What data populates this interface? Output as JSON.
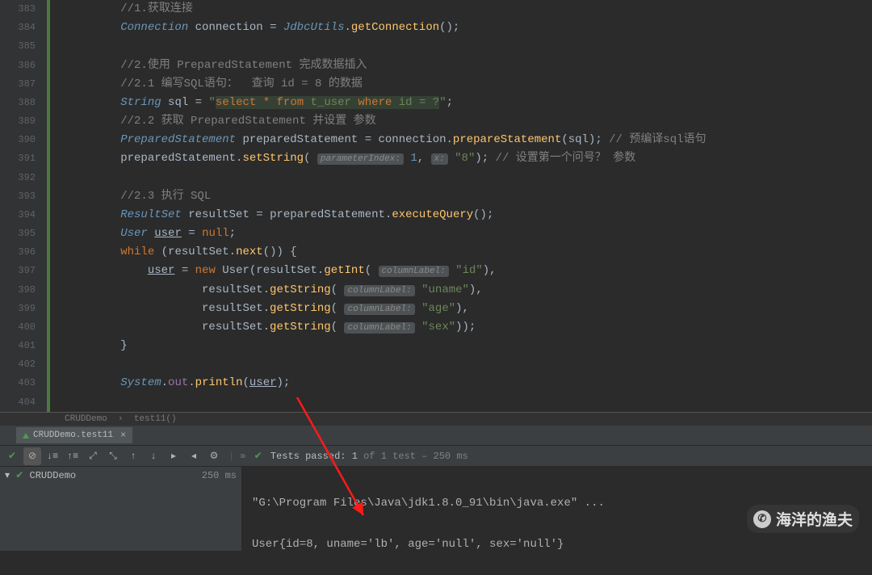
{
  "lines": [
    {
      "num": "383",
      "kind": "comment",
      "text": "//1.获取连接"
    },
    {
      "num": "384",
      "kind": "conn"
    },
    {
      "num": "385",
      "kind": "blank"
    },
    {
      "num": "386",
      "kind": "comment",
      "text": "//2.使用 PreparedStatement 完成数据插入"
    },
    {
      "num": "387",
      "kind": "comment",
      "text": "//2.1 编写SQL语句：  查询 id = 8 的数据"
    },
    {
      "num": "388",
      "kind": "sql"
    },
    {
      "num": "389",
      "kind": "comment",
      "text": "//2.2 获取 PreparedStatement 并设置 参数"
    },
    {
      "num": "390",
      "kind": "prep"
    },
    {
      "num": "391",
      "kind": "setstr"
    },
    {
      "num": "392",
      "kind": "blank"
    },
    {
      "num": "393",
      "kind": "comment",
      "text": "//2.3 执行 SQL"
    },
    {
      "num": "394",
      "kind": "resultset"
    },
    {
      "num": "395",
      "kind": "usernull"
    },
    {
      "num": "396",
      "kind": "while"
    },
    {
      "num": "397",
      "kind": "newuser_id"
    },
    {
      "num": "398",
      "kind": "getstr",
      "col": "uname"
    },
    {
      "num": "399",
      "kind": "getstr",
      "col": "age"
    },
    {
      "num": "400",
      "kind": "getstr_last",
      "col": "sex"
    },
    {
      "num": "401",
      "kind": "closebrace"
    },
    {
      "num": "402",
      "kind": "blank"
    },
    {
      "num": "403",
      "kind": "println"
    },
    {
      "num": "404",
      "kind": "blank"
    }
  ],
  "tokens": {
    "Connection": "Connection",
    "connection": "connection",
    "JdbcUtils": "JdbcUtils",
    "getConnection": "getConnection",
    "String": "String",
    "sql": "sql",
    "sql_select": "select",
    "sql_star": "*",
    "sql_from": "from",
    "sql_tuser": "t_user",
    "sql_where": "where",
    "sql_id": "id",
    "sql_eq": "=",
    "sql_q": "?",
    "PreparedStatement": "PreparedStatement",
    "preparedStatement": "preparedStatement",
    "prepareStatement": "prepareStatement",
    "comment_precompile": "// 预编译sql语句",
    "setString": "setString",
    "paramIndex": "parameterIndex:",
    "one": "1",
    "x": "x:",
    "eight": "\"8\"",
    "comment_setparam": "// 设置第一个问号？ 参数",
    "ResultSet": "ResultSet",
    "resultSet": "resultSet",
    "executeQuery": "executeQuery",
    "User": "User",
    "user": "user",
    "nullk": "null",
    "while": "while",
    "next": "next",
    "new": "new",
    "getInt": "getInt",
    "columnLabel": "columnLabel:",
    "id": "\"id\"",
    "getString": "getString",
    "uname": "\"uname\"",
    "age": "\"age\"",
    "sex": "\"sex\"",
    "System": "System",
    "out": "out",
    "println": "println"
  },
  "breadcrumb": {
    "a": "CRUDDemo",
    "b": "test11()"
  },
  "tab": {
    "name": "CRUDDemo.test11"
  },
  "tests": {
    "label": "Tests passed:",
    "count": "1",
    "of": "of 1 test – 250 ms"
  },
  "tree": {
    "name": "CRUDDemo",
    "time": "250 ms"
  },
  "output": {
    "l1": "\"G:\\Program Files\\Java\\jdk1.8.0_91\\bin\\java.exe\" ...",
    "l2": "User{id=8, uname='lb', age='null', sex='null'}"
  },
  "watermark": "海洋的渔夫"
}
